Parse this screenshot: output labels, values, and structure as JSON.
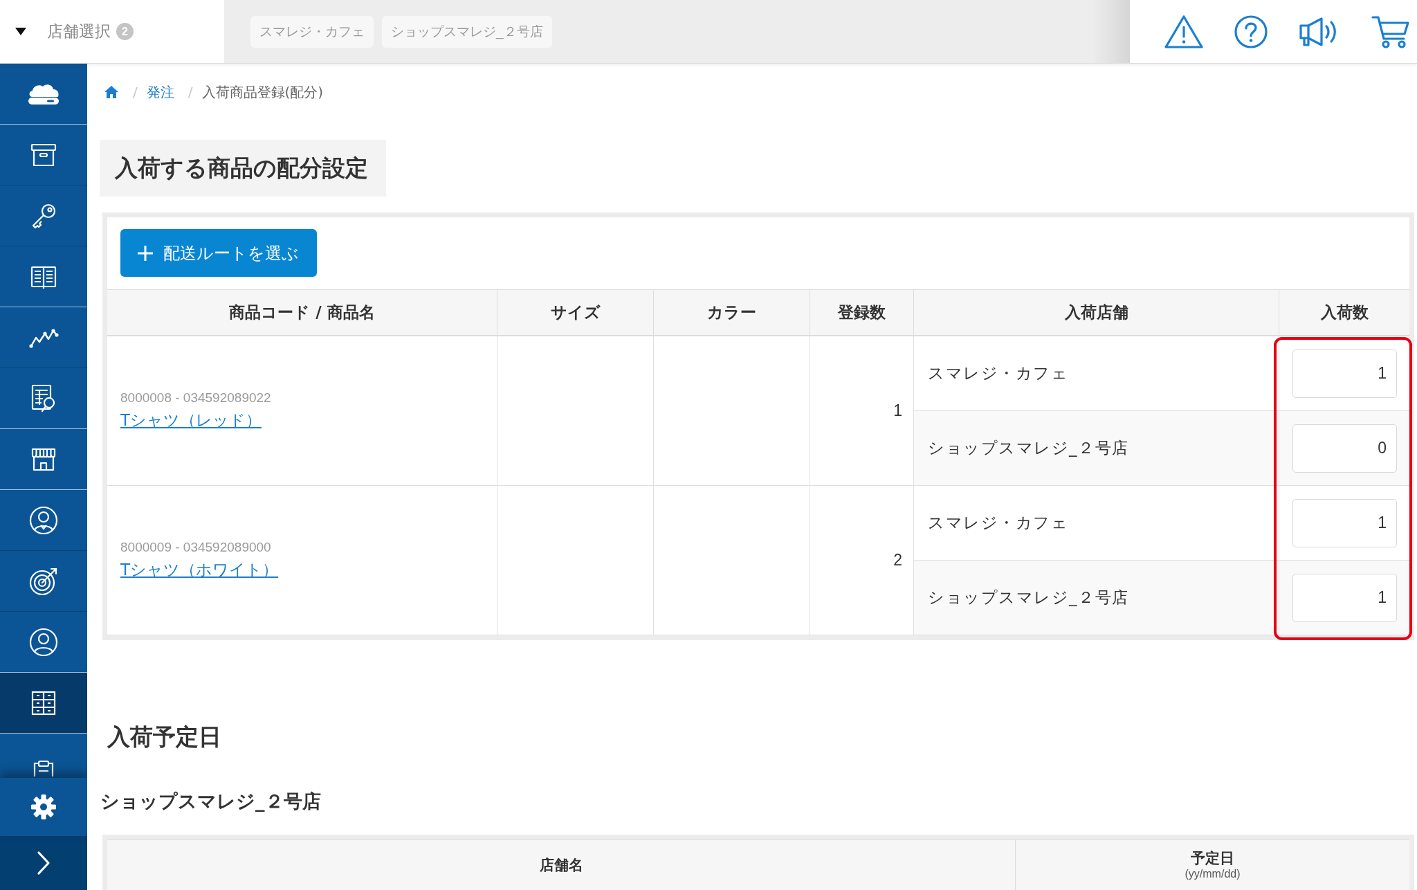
{
  "top_bar": {
    "store_selector": {
      "label": "店舗選択",
      "count": "2"
    },
    "selected_stores": [
      "スマレジ・カフェ",
      "ショップスマレジ_２号店"
    ]
  },
  "sidebar": {
    "items": [
      {
        "selected": false
      },
      {
        "selected": false
      },
      {
        "selected": false
      },
      {
        "selected": false
      },
      {
        "selected": false
      },
      {
        "selected": false
      },
      {
        "selected": false
      },
      {
        "selected": false
      },
      {
        "selected": false
      },
      {
        "selected": false
      },
      {
        "selected": true
      },
      {
        "selected": false
      }
    ]
  },
  "breadcrumb": {
    "separator": "/",
    "items": [
      {
        "kind": "home"
      },
      {
        "kind": "link",
        "label": "発注"
      },
      {
        "kind": "current",
        "label": "入荷商品登録(配分)"
      }
    ]
  },
  "page_title": "入荷する商品の配分設定",
  "add_route_button": {
    "label": "配送ルートを選ぶ"
  },
  "allocation_table": {
    "columns": [
      {
        "label": "商品コード / 商品名",
        "highlighted": false
      },
      {
        "label": "サイズ",
        "highlighted": false
      },
      {
        "label": "カラー",
        "highlighted": false
      },
      {
        "label": "登録数",
        "highlighted": false
      },
      {
        "label": "入荷店舗",
        "highlighted": false
      },
      {
        "label": "入荷数",
        "highlighted": true
      }
    ],
    "rows": [
      {
        "code": "8000008 - 034592089022",
        "name": "Tシャツ（レッド）",
        "registered": "1",
        "allocations": [
          {
            "store": "スマレジ・カフェ",
            "quantity": "1"
          },
          {
            "store": "ショップスマレジ_２号店",
            "quantity": "0"
          }
        ]
      },
      {
        "code": "8000009 - 034592089000",
        "name": "Tシャツ（ホワイト）",
        "registered": "2",
        "allocations": [
          {
            "store": "スマレジ・カフェ",
            "quantity": "1"
          },
          {
            "store": "ショップスマレジ_２号店",
            "quantity": "1"
          }
        ]
      }
    ]
  },
  "schedule": {
    "title": "入荷予定日",
    "store": "ショップスマレジ_２号店",
    "columns": [
      {
        "label": "店舗名"
      },
      {
        "label": "予定日",
        "hint": "(yy/mm/dd)"
      }
    ]
  }
}
